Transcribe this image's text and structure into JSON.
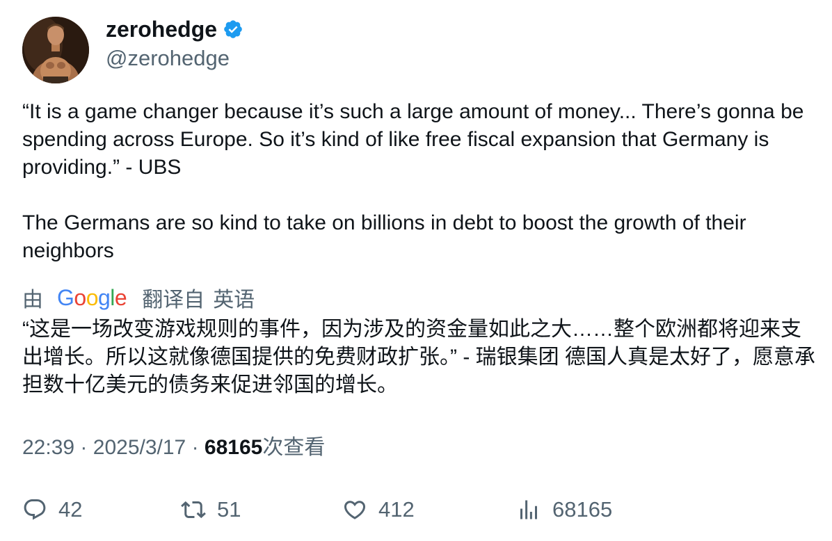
{
  "user": {
    "display_name": "zerohedge",
    "handle": "@zerohedge"
  },
  "tweet": {
    "paragraph1": "“It is a game changer because it’s such a large amount of money... There’s gonna be spending across Europe. So it’s kind of like free fiscal expansion that Germany is providing.” - UBS",
    "paragraph2": "The Germans are so kind to take on billions in debt to boost the growth of their neighbors"
  },
  "translation": {
    "by_label": "由",
    "provider": "Google",
    "from_label": "翻译自",
    "language": "英语",
    "text": "“这是一场改变游戏规则的事件，因为涉及的资金量如此之大……整个欧洲都将迎来支出增长。所以这就像德国提供的免费财政扩张。” - 瑞银集团 德国人真是太好了，愿意承担数十亿美元的债务来促进邻国的增长。"
  },
  "meta": {
    "time": "22:39",
    "separator": "·",
    "date": "2025/3/17",
    "views_count": "68165",
    "views_label": "次查看"
  },
  "actions": {
    "replies": "42",
    "retweets": "51",
    "likes": "412",
    "views": "68165"
  },
  "colors": {
    "verified": "#1d9bf0",
    "secondary_text": "#536471",
    "primary_text": "#0f1419"
  },
  "icons": [
    "verified-badge-icon",
    "reply-icon",
    "retweet-icon",
    "like-icon",
    "views-icon"
  ]
}
